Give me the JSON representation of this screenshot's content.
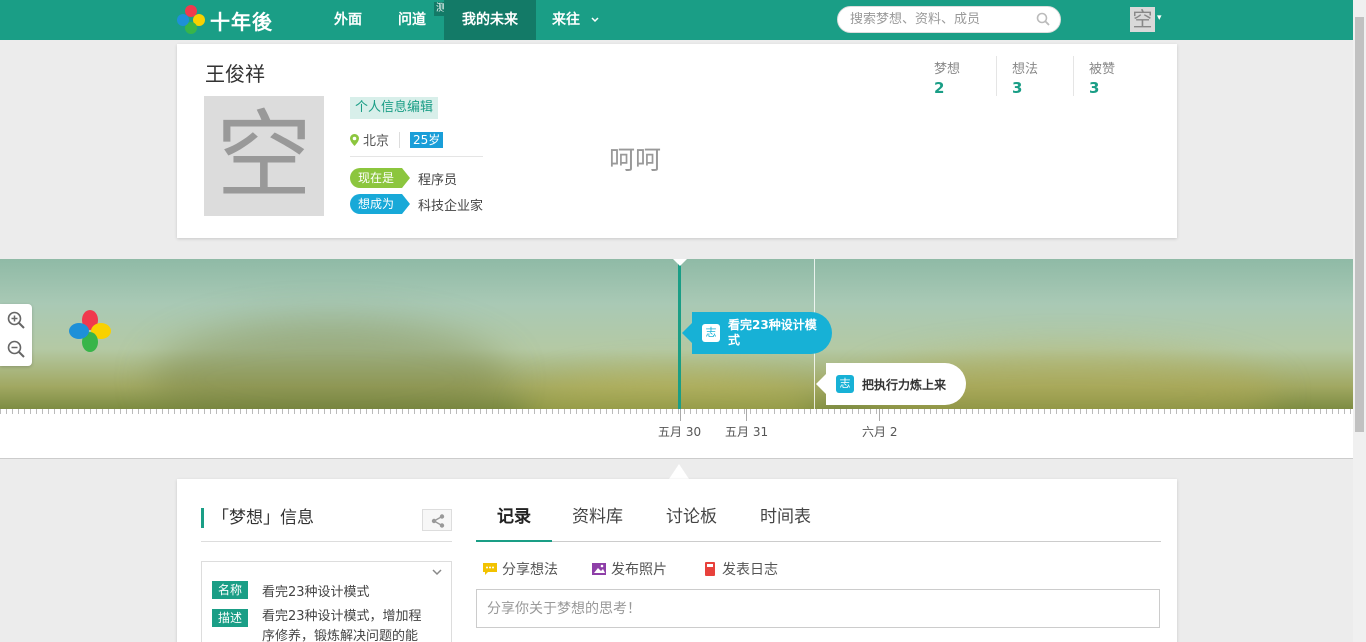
{
  "brand": {
    "logo_text": "十年後"
  },
  "nav": {
    "items": [
      {
        "label": "外面"
      },
      {
        "label": "问道",
        "badge": "测"
      },
      {
        "label": "我的未来"
      },
      {
        "label": "来往"
      }
    ]
  },
  "search": {
    "placeholder": "搜索梦想、资料、成员"
  },
  "user_avatar_glyph": "空",
  "profile": {
    "name": "王俊祥",
    "avatar_glyph": "空",
    "edit_label": "个人信息编辑",
    "city": "北京",
    "age": "25岁",
    "now_tag": "现在是",
    "now_value": "程序员",
    "want_tag": "想成为",
    "want_value": "科技企业家",
    "motto": "呵呵",
    "stats": [
      {
        "label": "梦想",
        "value": "2"
      },
      {
        "label": "想法",
        "value": "3"
      },
      {
        "label": "被赞",
        "value": "3"
      }
    ]
  },
  "timeline": {
    "events": [
      {
        "icon_text": "志",
        "text": "看完23种设计模式"
      },
      {
        "icon_text": "志",
        "text": "把执行力炼上来"
      }
    ],
    "date_labels": [
      "五月 30",
      "五月 31",
      "六月 2"
    ]
  },
  "dream": {
    "title": "「梦想」信息",
    "name_tag": "名称",
    "name_value": "看完23种设计模式",
    "desc_tag": "描述",
    "desc_value": "看完23种设计模式，增加程序修养，锻炼解决问题的能"
  },
  "tabs": [
    {
      "label": "记录"
    },
    {
      "label": "资料库"
    },
    {
      "label": "讨论板"
    },
    {
      "label": "时间表"
    }
  ],
  "actions": [
    {
      "label": "分享想法"
    },
    {
      "label": "发布照片"
    },
    {
      "label": "发表日志"
    }
  ],
  "post": {
    "placeholder": "分享你关于梦想的思考！"
  },
  "colors": {
    "brand_green": "#1a9e86",
    "nav_active": "#137a67",
    "tag_now": "#8cc63e",
    "tag_want": "#18a9d8",
    "event_blue": "#17b1d6"
  }
}
